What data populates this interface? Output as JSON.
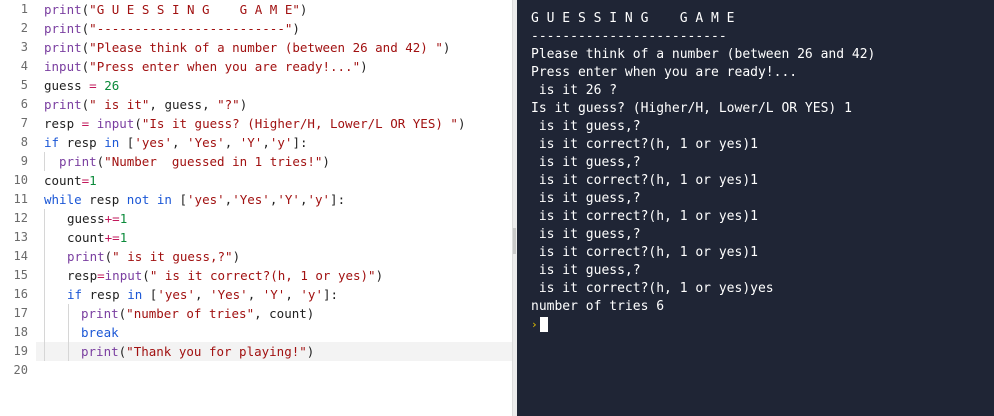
{
  "editor": {
    "current_line": "19",
    "line_numbers": [
      "1",
      "2",
      "3",
      "4",
      "5",
      "6",
      "7",
      "8",
      "9",
      "10",
      "11",
      "12",
      "13",
      "14",
      "15",
      "16",
      "17",
      "18",
      "19",
      "20"
    ]
  },
  "code": {
    "l1": {
      "fn": "print",
      "p1": "(",
      "s1": "\"G U E S S I N G    G A M E\"",
      "p2": ")"
    },
    "l2": {
      "fn": "print",
      "p1": "(",
      "s1": "\"-------------------------\"",
      "p2": ")"
    },
    "l3": {
      "fn": "print",
      "p1": "(",
      "s1": "\"Please think of a number (between 26 and 42) \"",
      "p2": ")"
    },
    "l4": {
      "fn": "input",
      "p1": "(",
      "s1": "\"Press enter when you are ready!...\"",
      "p2": ")"
    },
    "l5": {
      "id1": "guess ",
      "op": "=",
      "n1": " 26"
    },
    "l6": {
      "fn": "print",
      "p1": "(",
      "s1": "\" is it\"",
      "p2": ", guess, ",
      "s2": "\"?\"",
      "p3": ")"
    },
    "l7": {
      "id1": "resp ",
      "op": "=",
      "fn": " input",
      "p1": "(",
      "s1": "\"Is it guess? (Higher/H, Lower/L OR YES) \"",
      "p2": ")"
    },
    "l8": {
      "kw1": "if",
      "id1": " resp ",
      "kw2": "in",
      "p1": " [",
      "s1": "'yes'",
      "p2": ", ",
      "s2": "'Yes'",
      "p3": ", ",
      "s3": "'Y'",
      "p4": ",",
      "s4": "'y'",
      "p5": "]:"
    },
    "l9": {
      "fn": "print",
      "p1": "(",
      "s1": "\"Number  guessed in 1 tries!\"",
      "p2": ")"
    },
    "l10": {
      "id1": "count",
      "op": "=",
      "n1": "1"
    },
    "l11": {
      "kw1": "while",
      "id1": " resp ",
      "kw2": "not in",
      "p1": " [",
      "s1": "'yes'",
      "p2": ",",
      "s2": "'Yes'",
      "p3": ",",
      "s3": "'Y'",
      "p4": ",",
      "s4": "'y'",
      "p5": "]:"
    },
    "l12": {
      "id1": "guess",
      "op": "+=",
      "n1": "1"
    },
    "l13": {
      "id1": "count",
      "op": "+=",
      "n1": "1"
    },
    "l14": {
      "fn": "print",
      "p1": "(",
      "s1": "\" is it guess,?\"",
      "p2": ")"
    },
    "l15": {
      "id1": "resp",
      "op": "=",
      "fn": "input",
      "p1": "(",
      "s1": "\" is it correct?(h, 1 or yes)\"",
      "p2": ")"
    },
    "l16": {
      "kw1": "if",
      "id1": " resp ",
      "kw2": "in",
      "p1": " [",
      "s1": "'yes'",
      "p2": ", ",
      "s2": "'Yes'",
      "p3": ", ",
      "s3": "'Y'",
      "p4": ", ",
      "s4": "'y'",
      "p5": "]:"
    },
    "l17": {
      "fn": "print",
      "p1": "(",
      "s1": "\"number of tries\"",
      "p2": ", count)"
    },
    "l18": {
      "kw1": "break"
    },
    "l19": {
      "fn": "print",
      "p1": "(",
      "s1": "\"Thank you for playing!\"",
      "p2": ")"
    }
  },
  "console": {
    "lines": [
      "G U E S S I N G    G A M E",
      "-------------------------",
      "Please think of a number (between 26 and 42)",
      "Press enter when you are ready!...",
      " is it 26 ?",
      "Is it guess? (Higher/H, Lower/L OR YES) 1",
      " is it guess,?",
      " is it correct?(h, 1 or yes)1",
      " is it guess,?",
      " is it correct?(h, 1 or yes)1",
      " is it guess,?",
      " is it correct?(h, 1 or yes)1",
      " is it guess,?",
      " is it correct?(h, 1 or yes)1",
      " is it guess,?",
      " is it correct?(h, 1 or yes)yes",
      "number of tries 6"
    ],
    "prompt_symbol": "›"
  },
  "colors": {
    "console_bg": "#1f2535",
    "keyword": "#1b57d6",
    "function": "#7a3ea0",
    "string": "#a11111",
    "number": "#0b8a3a",
    "operator": "#c2185b"
  }
}
